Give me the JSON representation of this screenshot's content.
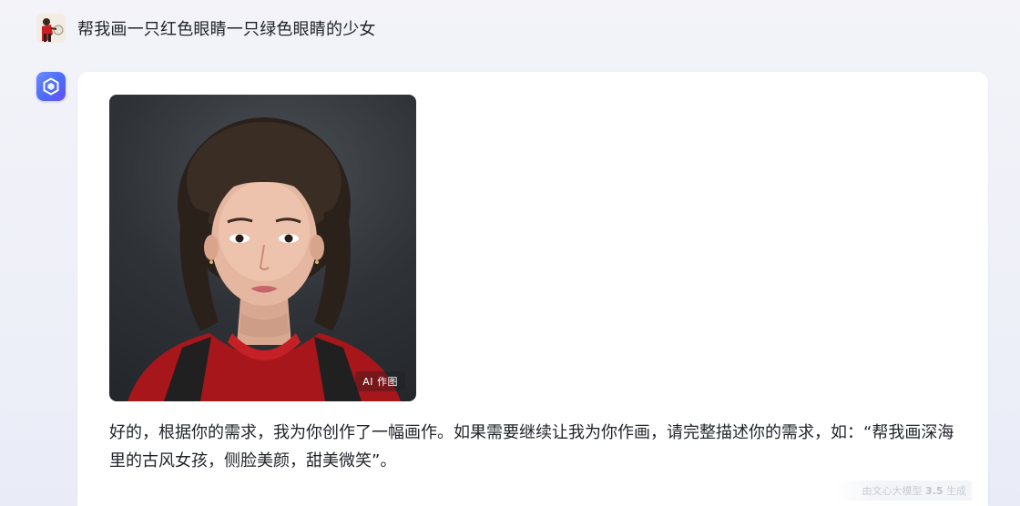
{
  "user": {
    "avatar_icon": "user-avatar-icon",
    "message": "帮我画一只红色眼睛一只绿色眼睛的少女"
  },
  "bot": {
    "avatar_icon": "ernie-bot-logo-icon",
    "image_badge": "AI 作图",
    "reply": "好的，根据你的需求，我为你创作了一幅画作。如果需要继续让我为你作画，请完整描述你的需求，如：“帮我画深海里的古风女孩，侧脸美颜，甜美微笑”。",
    "footer_prefix": "由文心大模型 ",
    "footer_version": "3.5",
    "footer_suffix": " 生成"
  },
  "colors": {
    "accent": "#4b6cf7",
    "background": "#f0f1f8",
    "card": "#ffffff"
  }
}
